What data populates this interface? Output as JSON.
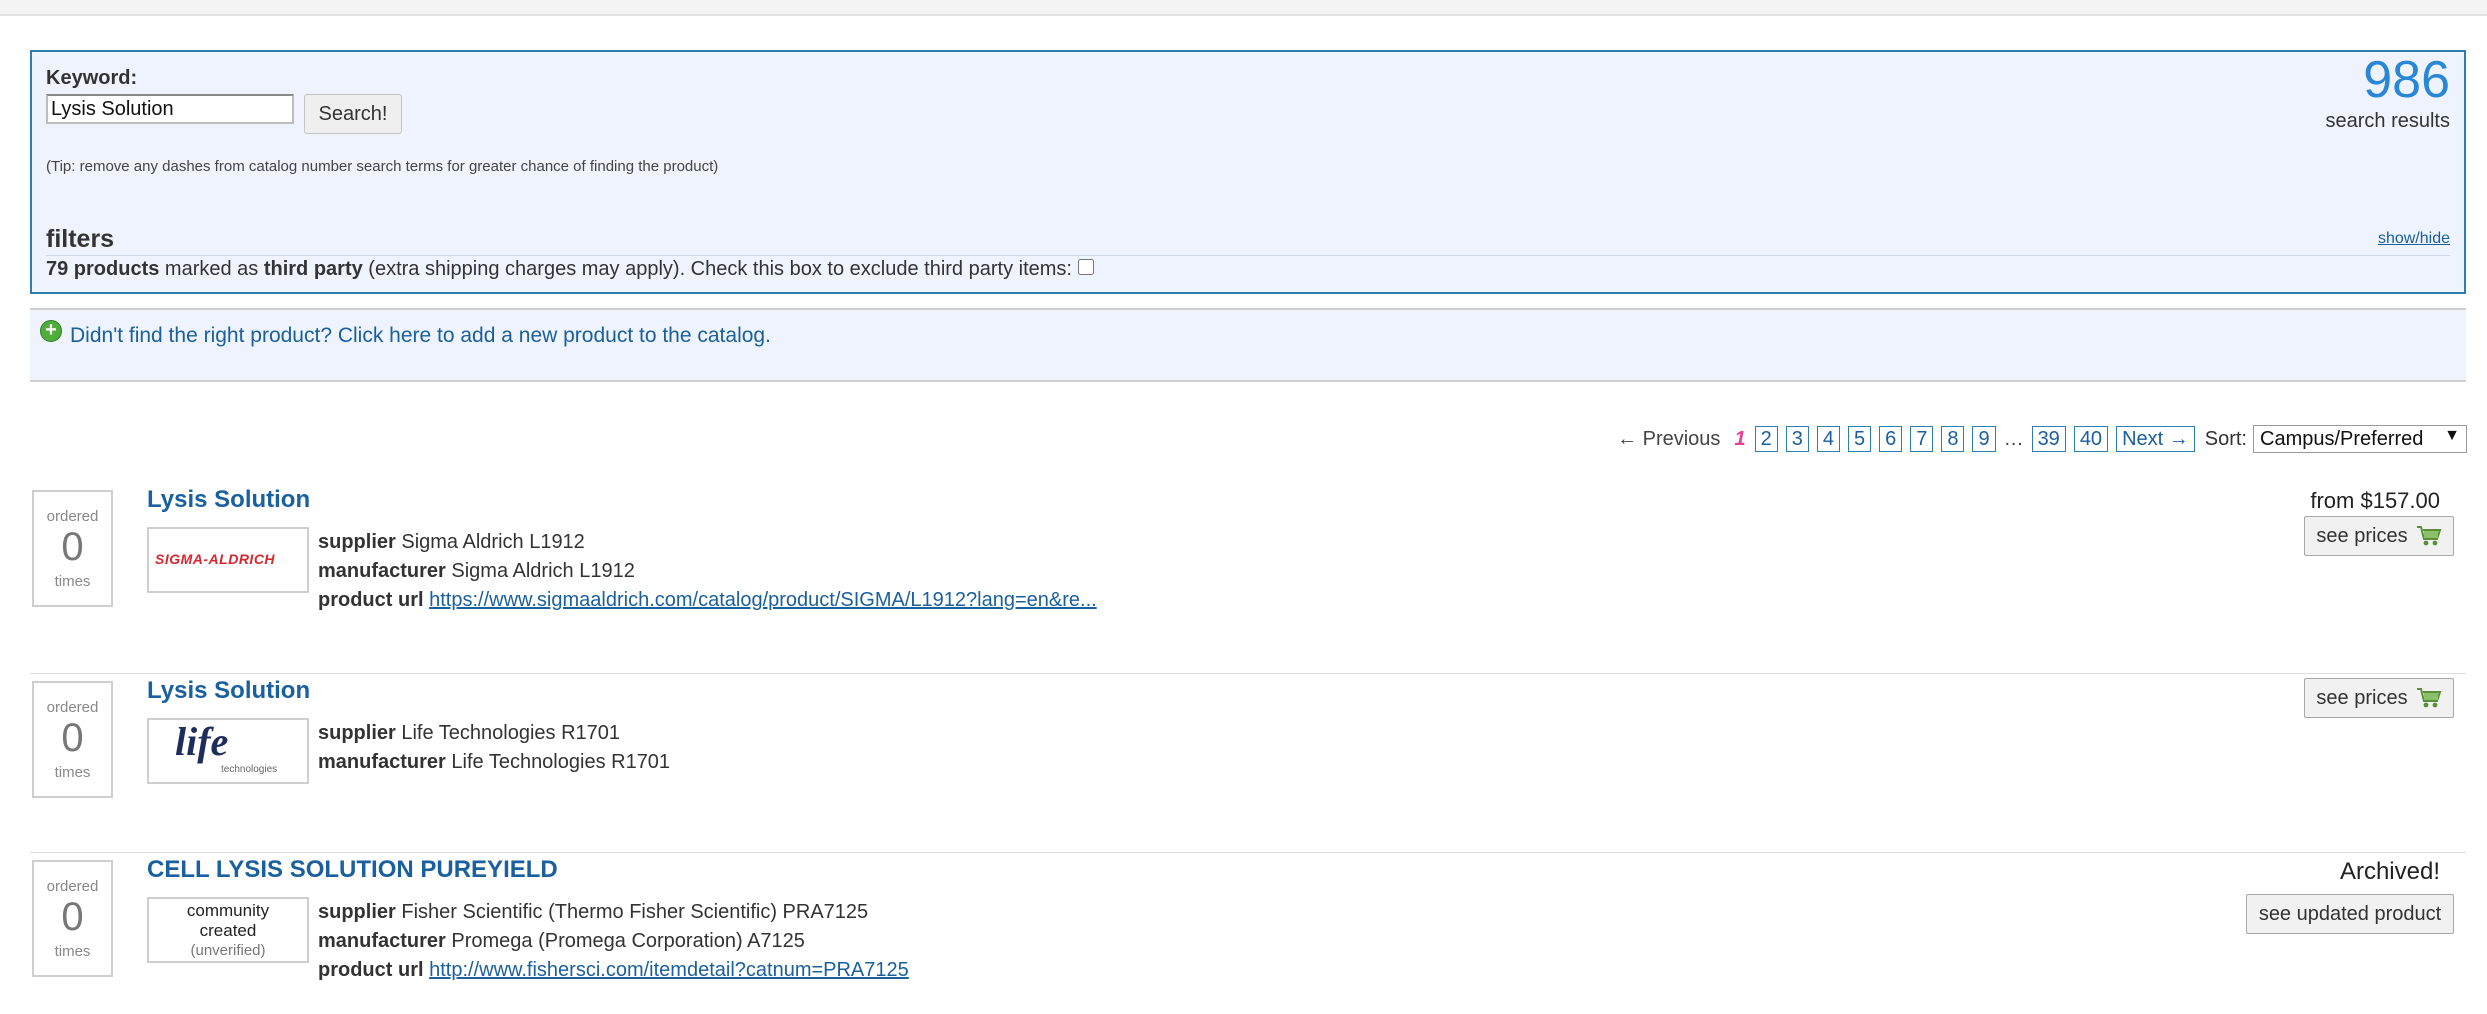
{
  "search": {
    "keyword_label": "Keyword:",
    "keyword_value": "Lysis Solution",
    "search_button": "Search!",
    "tip": "(Tip: remove any dashes from catalog number search terms for greater chance of finding the product)",
    "results_count": "986",
    "results_label": "search results"
  },
  "filters": {
    "title": "filters",
    "show_hide": "show/hide",
    "third_party_count": "79 products",
    "third_party_mid": " marked as ",
    "third_party_bold": "third party",
    "third_party_rest": " (extra shipping charges may apply). Check this box to exclude third party items:"
  },
  "add_product": {
    "link_text": "Didn't find the right product? Click here to add a new product to the catalog."
  },
  "pagination": {
    "previous": "← Previous",
    "current": "1",
    "pages": [
      "2",
      "3",
      "4",
      "5",
      "6",
      "7",
      "8",
      "9"
    ],
    "ellipsis": "…",
    "last_pages": [
      "39",
      "40"
    ],
    "next": "Next →",
    "sort_label": "Sort:",
    "sort_selected": "Campus/Preferred"
  },
  "results": [
    {
      "ordered_label": "ordered",
      "ordered_count": "0",
      "ordered_suffix": "times",
      "title": "Lysis Solution",
      "logo_text": "SIGMA-ALDRICH",
      "supplier_label": "supplier",
      "supplier": "Sigma Aldrich L1912",
      "manufacturer_label": "manufacturer",
      "manufacturer": "Sigma Aldrich L1912",
      "url_label": "product url",
      "url": "https://www.sigmaaldrich.com/catalog/product/SIGMA/L1912?lang=en&re...",
      "price": "from $157.00",
      "button": "see prices"
    },
    {
      "ordered_label": "ordered",
      "ordered_count": "0",
      "ordered_suffix": "times",
      "title": "Lysis Solution",
      "logo_text": "life",
      "logo_sub": "technologies",
      "supplier_label": "supplier",
      "supplier": "Life Technologies R1701",
      "manufacturer_label": "manufacturer",
      "manufacturer": "Life Technologies R1701",
      "button": "see prices"
    },
    {
      "ordered_label": "ordered",
      "ordered_count": "0",
      "ordered_suffix": "times",
      "title": "CELL LYSIS SOLUTION PUREYIELD",
      "logo_line1": "community",
      "logo_line2": "created",
      "logo_line3": "(unverified)",
      "supplier_label": "supplier",
      "supplier": "Fisher Scientific (Thermo Fisher Scientific) PRA7125",
      "manufacturer_label": "manufacturer",
      "manufacturer": "Promega (Promega Corporation) A7125",
      "url_label": "product url",
      "url": "http://www.fishersci.com/itemdetail?catnum=PRA7125",
      "status": "Archived!",
      "button": "see updated product"
    }
  ],
  "colors": {
    "link_blue": "#1a5f9e",
    "count_blue": "#2a86d6",
    "panel_bg": "#eef3fd",
    "current_page_pink": "#e63f95",
    "sigma_red": "#d9262e"
  }
}
